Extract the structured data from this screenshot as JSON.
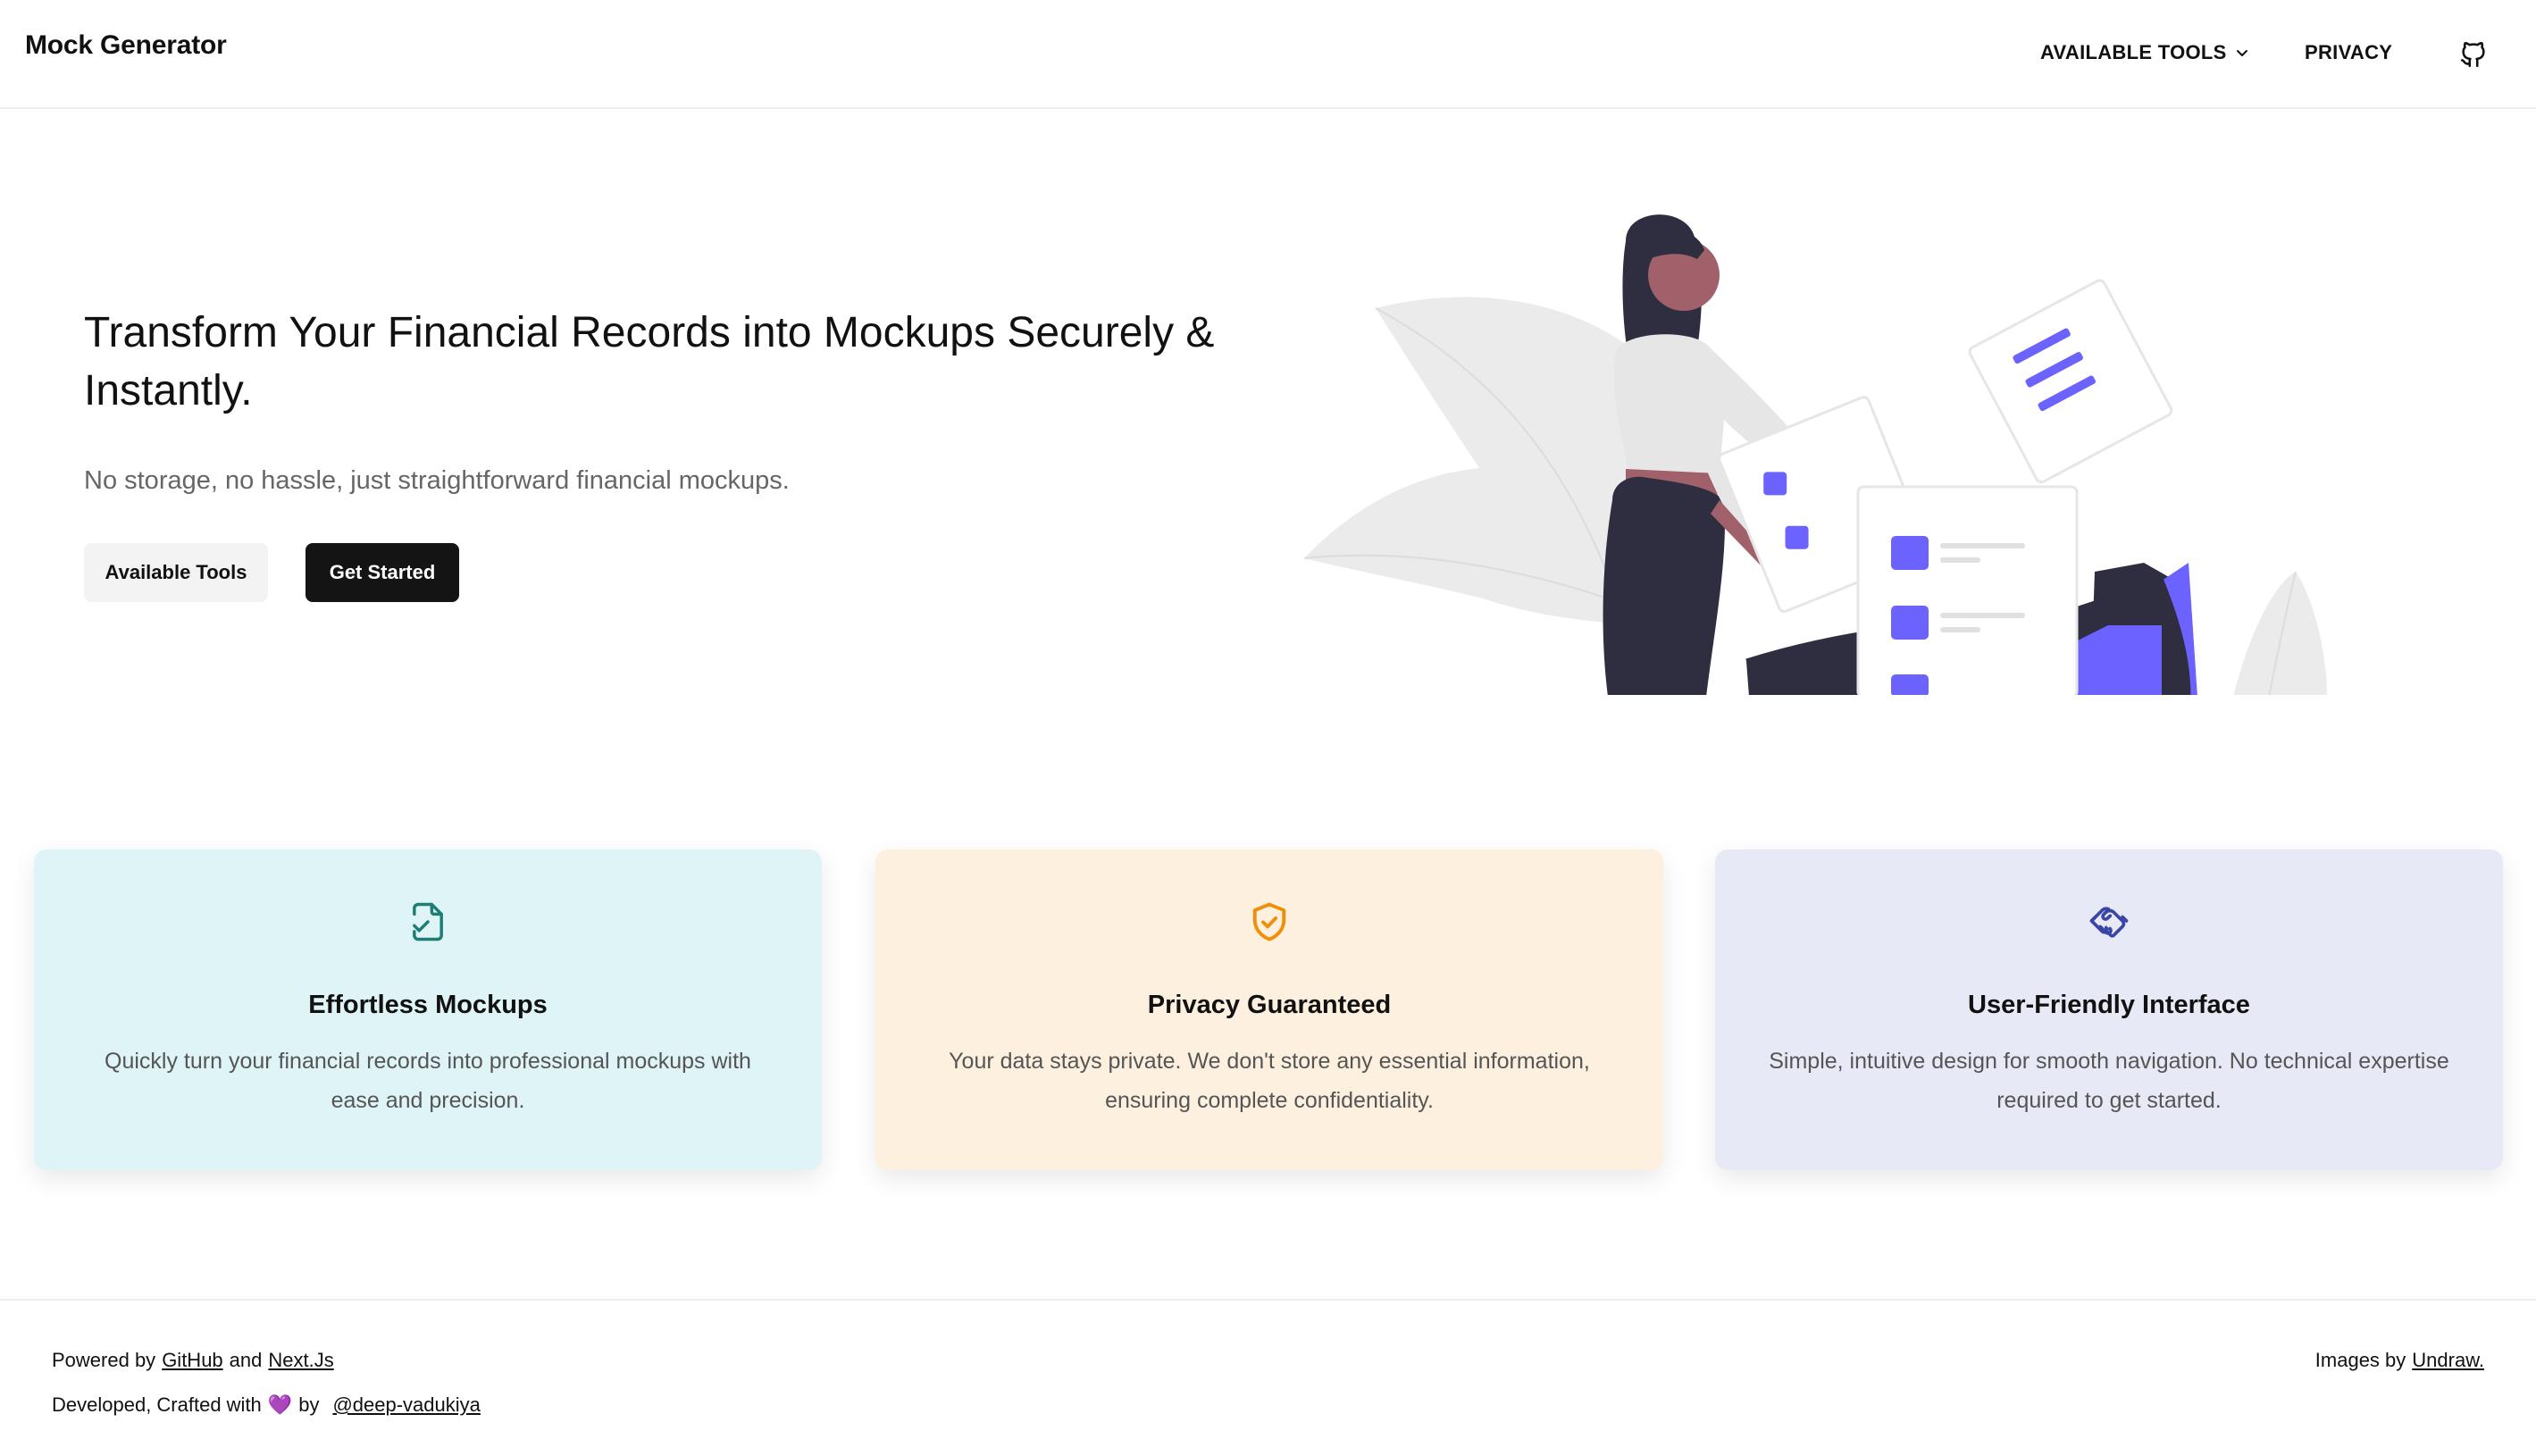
{
  "header": {
    "brand": "Mock Generator",
    "nav": {
      "tools_label": "AVAILABLE TOOLS",
      "privacy_label": "PRIVACY"
    }
  },
  "hero": {
    "title": "Transform Your Financial Records into Mockups Securely & Instantly.",
    "subtitle": "No storage, no hassle, just straightforward financial mockups.",
    "secondary_button": "Available Tools",
    "primary_button": "Get Started"
  },
  "features": [
    {
      "title": "Effortless Mockups",
      "description": "Quickly turn your financial records into professional mockups with ease and precision.",
      "icon": "file-check-icon",
      "icon_color": "#1e7d74",
      "background": "#dff4f7"
    },
    {
      "title": "Privacy Guaranteed",
      "description": "Your data stays private. We don't store any essential information, ensuring complete confidentiality.",
      "icon": "shield-check-icon",
      "icon_color": "#f0900a",
      "background": "#fdf0df"
    },
    {
      "title": "User-Friendly Interface",
      "description": "Simple, intuitive design for smooth navigation. No technical expertise required to get started.",
      "icon": "handshake-icon",
      "icon_color": "#3a45a8",
      "background": "#e8e9f6"
    }
  ],
  "footer": {
    "powered_prefix": "Powered by",
    "github_link": "GitHub",
    "and_text": "and",
    "nextjs_link": "Next.Js",
    "developed_text": "Developed, Crafted with",
    "heart": "💜",
    "by_text": "by",
    "author_link": "@deep-vadukiya",
    "images_prefix": "Images by",
    "undraw_link": "Undraw."
  },
  "colors": {
    "primary_button": "#141414",
    "illustration_accent": "#6c63ff",
    "illustration_dark": "#2f2e41"
  }
}
